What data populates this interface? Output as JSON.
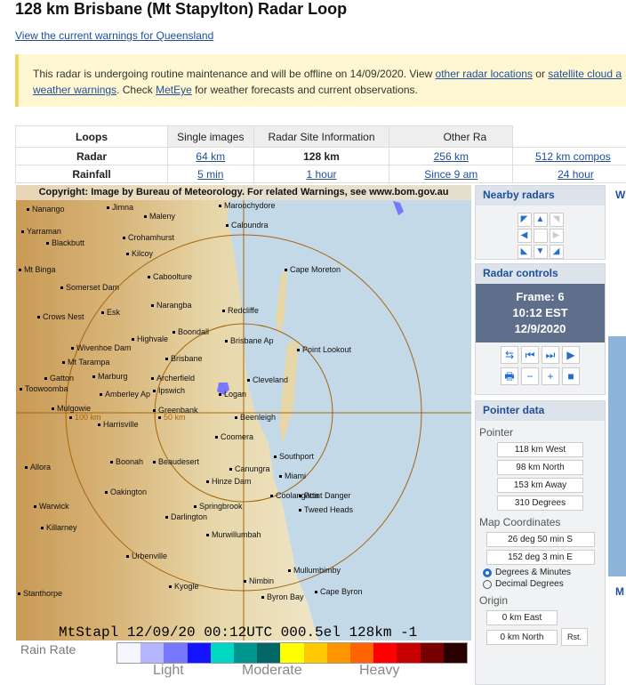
{
  "title": "128 km Brisbane (Mt Stapylton) Radar Loop",
  "warnings_link": "View the current warnings for Queensland",
  "notice": {
    "t1": "This radar is undergoing routine maintenance and will be offline on 14/09/2020. View ",
    "l1": "other radar locations",
    "t2": " or ",
    "l2": "satellite cloud a",
    "l3": "weather warnings",
    "t3": ". Check ",
    "l4": "MetEye",
    "t4": " for weather forecasts and current observations."
  },
  "nav": {
    "tabs": [
      "Loops",
      "Single images",
      "Radar Site Information",
      "Other Ra"
    ],
    "radar_label": "Radar",
    "radar_ranges": [
      "64 km",
      "128 km",
      "256 km",
      "512 km compos"
    ],
    "rain_label": "Rainfall",
    "rain_ranges": [
      "5 min",
      "1 hour",
      "Since 9 am",
      "24 hour"
    ]
  },
  "map": {
    "copyright": "Copyright: Image by Bureau of Meteorology. For related Warnings, see www.bom.gov.au",
    "timestamp": "MtStapl 12/09/20 00:12UTC 000.5el 128km -1",
    "ring_labels": [
      "100 km",
      "50 km"
    ],
    "places": [
      "Nanango",
      "Jimna",
      "Maroochydore",
      "Maleny",
      "Caloundra",
      "Yarraman",
      "Crohamhurst",
      "Blackbutt",
      "Kilcoy",
      "Mt Binga",
      "Caboolture",
      "Cape Moreton",
      "Somerset Dam",
      "Narangba",
      "Redcliffe",
      "Crows Nest",
      "Esk",
      "Boondall",
      "Highvale",
      "Brisbane Ap",
      "Point Lookout",
      "Wivenhoe Dam",
      "Brisbane",
      "Mt Tarampa",
      "Marburg",
      "Archerfield",
      "Cleveland",
      "Gatton",
      "Toowoomba",
      "Amberley Ap",
      "Ipswich",
      "Logan",
      "Mulgowie",
      "Greenbank",
      "Beenleigh",
      "Harrisville",
      "Coomera",
      "Southport",
      "Allora",
      "Boonah",
      "Beaudesert",
      "Canungra",
      "Miami",
      "Hinze Dam",
      "Oakington",
      "Coolangatta",
      "Point Danger",
      "Warwick",
      "Springbrook",
      "Tweed Heads",
      "Darlington",
      "Killarney",
      "Murwillumbah",
      "Urbenville",
      "Mullumbimby",
      "Nimbin",
      "Kyogle",
      "Stanthorpe",
      "Cape Byron",
      "Byron Bay"
    ]
  },
  "rain_rate": {
    "label": "Rain Rate",
    "light": "Light",
    "moderate": "Moderate",
    "heavy": "Heavy",
    "colors": [
      "#f5f5ff",
      "#b4b4ff",
      "#7878ff",
      "#1414ff",
      "#00d8c3",
      "#009690",
      "#006666",
      "#ffff00",
      "#ffc800",
      "#ff9600",
      "#ff6400",
      "#ff0000",
      "#c80000",
      "#780000",
      "#280000"
    ]
  },
  "nearby": {
    "title": "Nearby radars",
    "icons": [
      "arrow-nw-icon",
      "arrow-n-icon",
      "arrow-ne-icon",
      "arrow-w-icon",
      "blank",
      "arrow-e-icon",
      "arrow-sw-icon",
      "arrow-s-icon",
      "arrow-se-icon"
    ]
  },
  "controls": {
    "title": "Radar controls",
    "frame": "Frame: 6",
    "time": "10:12 EST",
    "date": "12/9/2020",
    "buttons": [
      "⇆",
      "⏮",
      "⏭",
      "▶",
      "🖶",
      "−",
      "+",
      "■"
    ]
  },
  "pointer": {
    "title": "Pointer data",
    "pointer_label": "Pointer",
    "values": [
      "118 km West",
      "98 km North",
      "153 km Away",
      "310 Degrees"
    ],
    "map_coords_label": "Map Coordinates",
    "coords": [
      "26 deg 50 min S",
      "152 deg 3 min E"
    ],
    "opt1": "Degrees & Minutes",
    "opt2": "Decimal Degrees",
    "origin_label": "Origin",
    "origin": [
      "0 km East",
      "0 km North"
    ],
    "reset": "Rst."
  },
  "side_letters": [
    "W",
    "M"
  ]
}
